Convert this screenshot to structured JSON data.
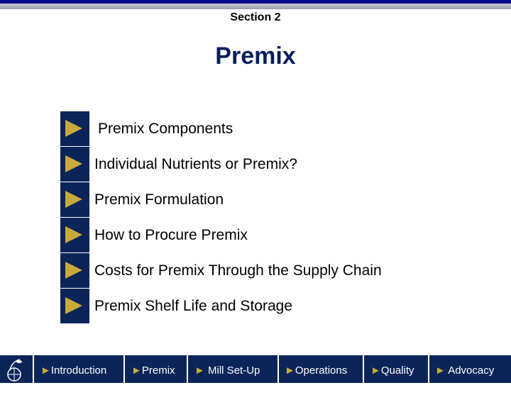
{
  "header": {
    "section": "Section 2",
    "title": "Premix"
  },
  "items": [
    {
      "label": "Premix Components"
    },
    {
      "label": "Individual Nutrients or Premix?"
    },
    {
      "label": "Premix Formulation"
    },
    {
      "label": "How to Procure Premix"
    },
    {
      "label": "Costs for Premix Through the Supply Chain"
    },
    {
      "label": "Premix Shelf Life and Storage"
    }
  ],
  "nav": {
    "arrow": "►",
    "items": [
      "Introduction",
      "Premix",
      " Mill Set-Up",
      "Operations",
      "Quality",
      " Advocacy"
    ]
  },
  "colors": {
    "navy": "#0b2558",
    "gold": "#c9a93a",
    "title": "#0a1f5c"
  }
}
